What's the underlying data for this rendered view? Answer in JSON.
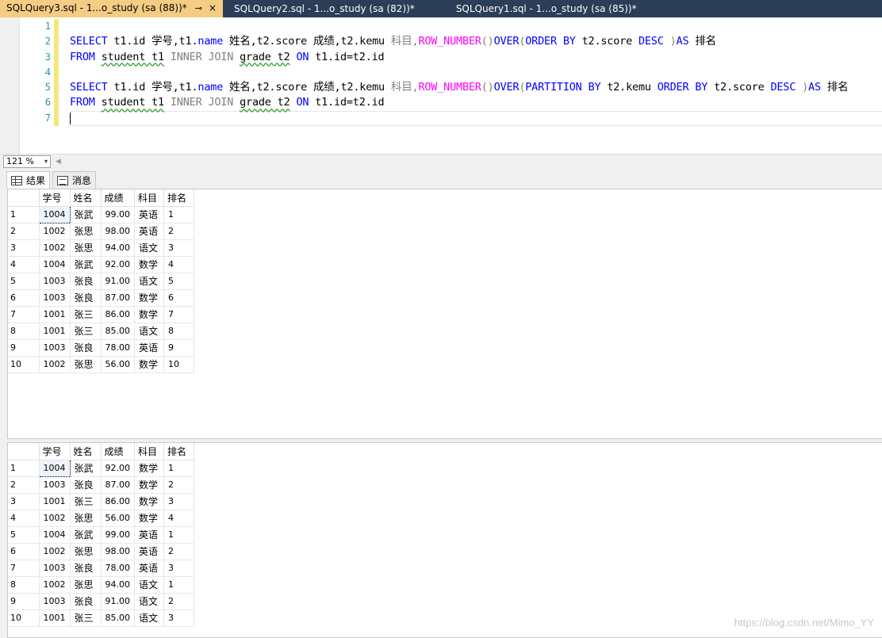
{
  "tabs": [
    {
      "label": "SQLQuery3.sql - 1...o_study (sa (88))*",
      "active": true,
      "pin": "⊸",
      "close": "×"
    },
    {
      "label": "SQLQuery2.sql - 1...o_study (sa (82))*",
      "active": false
    },
    {
      "label": "SQLQuery1.sql - 1...o_study (sa (85))*",
      "active": false
    }
  ],
  "editor": {
    "line_numbers": [
      "1",
      "2",
      "3",
      "4",
      "5",
      "6",
      "7"
    ],
    "line2": {
      "t1": "SELECT",
      "t2": " t1.",
      "t3": "id",
      "t4": " 学号,t1.",
      "t5": "name",
      "t6": " 姓名,t2.",
      "t7": "score",
      "t8": " 成绩,t2.",
      "t9": "kemu",
      "t10": " 科目,",
      "t11": "ROW_NUMBER",
      "t12": "()",
      "t13": "OVER",
      "t14": "(",
      "t15": "ORDER BY",
      "t16": " t2.score ",
      "t17": "DESC",
      "t18": " )",
      "t19": "AS",
      "t20": " 排名"
    },
    "line3": {
      "t1": "FROM",
      "t2": " ",
      "t3": "student t1",
      "t4": " ",
      "t5": "INNER JOIN",
      "t6": " ",
      "t7": "grade t2",
      "t8": " ",
      "t9": "ON",
      "t10": " t1.id=t2.id"
    },
    "line5": {
      "t1": "SELECT",
      "t2": " t1.",
      "t3": "id",
      "t4": " 学号,t1.",
      "t5": "name",
      "t6": " 姓名,t2.",
      "t7": "score",
      "t8": " 成绩,t2.",
      "t9": "kemu",
      "t10": " 科目,",
      "t11": "ROW_NUMBER",
      "t12": "()",
      "t13": "OVER",
      "t14": "(",
      "t15": "PARTITION BY",
      "t16": " t2.kemu ",
      "t17": "ORDER BY",
      "t18": " t2.score ",
      "t19": "DESC",
      "t20": " )",
      "t21": "AS",
      "t22": " 排名"
    },
    "line6": {
      "t1": "FROM",
      "t2": " ",
      "t3": "student t1",
      "t4": " ",
      "t5": "INNER JOIN",
      "t6": " ",
      "t7": "grade t2",
      "t8": " ",
      "t9": "ON",
      "t10": " t1.id=t2.id"
    }
  },
  "zoom": {
    "value": "121 %",
    "dropdown_icon": "▾",
    "scroll_left_icon": "◀"
  },
  "result_tabs": {
    "results": "结果",
    "messages": "消息"
  },
  "columns": [
    "学号",
    "姓名",
    "成绩",
    "科目",
    "排名"
  ],
  "grid1": [
    [
      "1",
      "1004",
      "张武",
      "99.00",
      "英语",
      "1"
    ],
    [
      "2",
      "1002",
      "张思",
      "98.00",
      "英语",
      "2"
    ],
    [
      "3",
      "1002",
      "张思",
      "94.00",
      "语文",
      "3"
    ],
    [
      "4",
      "1004",
      "张武",
      "92.00",
      "数学",
      "4"
    ],
    [
      "5",
      "1003",
      "张良",
      "91.00",
      "语文",
      "5"
    ],
    [
      "6",
      "1003",
      "张良",
      "87.00",
      "数学",
      "6"
    ],
    [
      "7",
      "1001",
      "张三",
      "86.00",
      "数学",
      "7"
    ],
    [
      "8",
      "1001",
      "张三",
      "85.00",
      "语文",
      "8"
    ],
    [
      "9",
      "1003",
      "张良",
      "78.00",
      "英语",
      "9"
    ],
    [
      "10",
      "1002",
      "张思",
      "56.00",
      "数学",
      "10"
    ]
  ],
  "grid2": [
    [
      "1",
      "1004",
      "张武",
      "92.00",
      "数学",
      "1"
    ],
    [
      "2",
      "1003",
      "张良",
      "87.00",
      "数学",
      "2"
    ],
    [
      "3",
      "1001",
      "张三",
      "86.00",
      "数学",
      "3"
    ],
    [
      "4",
      "1002",
      "张思",
      "56.00",
      "数学",
      "4"
    ],
    [
      "5",
      "1004",
      "张武",
      "99.00",
      "英语",
      "1"
    ],
    [
      "6",
      "1002",
      "张思",
      "98.00",
      "英语",
      "2"
    ],
    [
      "7",
      "1003",
      "张良",
      "78.00",
      "英语",
      "3"
    ],
    [
      "8",
      "1002",
      "张思",
      "94.00",
      "语文",
      "1"
    ],
    [
      "9",
      "1003",
      "张良",
      "91.00",
      "语文",
      "2"
    ],
    [
      "10",
      "1001",
      "张三",
      "85.00",
      "语文",
      "3"
    ]
  ],
  "watermark": "https://blog.csdn.net/Mimo_YY",
  "colors": {
    "tab_active": "#f5cc84",
    "tabstrip": "#2b3d57",
    "keyword": "#0000ff",
    "function": "#ff00ff",
    "gray_keyword": "#808080",
    "line_number": "#2b91af"
  }
}
